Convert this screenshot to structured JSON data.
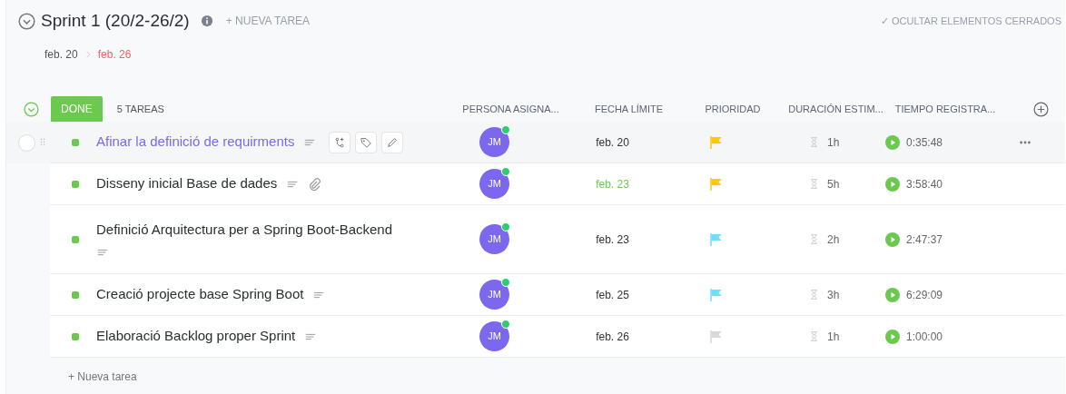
{
  "sprint": {
    "title": "Sprint 1 (20/2-26/2)",
    "new_task": "+ NUEVA TAREA",
    "hide_closed": "✓ OCULTAR ELEMENTOS CERRADOS",
    "start": "feb. 20",
    "end": "feb. 26",
    "expanded": true
  },
  "group": {
    "status": "DONE",
    "count": "5 TAREAS",
    "expanded": true
  },
  "columns": [
    "PERSONA ASIGNA...",
    "FECHA LÍMITE",
    "PRIORIDAD",
    "DURACIÓN ESTIM...",
    "TIEMPO REGISTRA..."
  ],
  "tasks": [
    {
      "name": "Afinar la definició de requirments",
      "hovered": true,
      "checked": false,
      "has_attachment": false,
      "assignee": "JM",
      "due": {
        "text": "feb. 20",
        "color": "#333333"
      },
      "priority": {
        "color": "#ffc800"
      },
      "estimate": "1h",
      "time": "0:35:48"
    },
    {
      "name": "Disseny inicial Base de dades",
      "hovered": false,
      "has_attachment": true,
      "assignee": "JM",
      "due": {
        "text": "feb. 23",
        "color": "#6bc950"
      },
      "priority": {
        "color": "#ffc800"
      },
      "estimate": "5h",
      "time": "3:58:40"
    },
    {
      "name": "Definició Arquitectura per a Spring Boot-Backend",
      "hovered": false,
      "has_attachment": false,
      "assignee": "JM",
      "due": {
        "text": "feb. 23",
        "color": "#333333"
      },
      "priority": {
        "color": "#6fddff"
      },
      "estimate": "2h",
      "time": "2:47:37"
    },
    {
      "name": "Creació projecte base Spring Boot",
      "hovered": false,
      "has_attachment": false,
      "assignee": "JM",
      "due": {
        "text": "feb. 25",
        "color": "#333333"
      },
      "priority": {
        "color": "#6fddff"
      },
      "estimate": "3h",
      "time": "6:29:09"
    },
    {
      "name": "Elaboració Backlog proper Sprint",
      "hovered": false,
      "has_attachment": false,
      "assignee": "JM",
      "due": {
        "text": "feb. 26",
        "color": "#333333"
      },
      "priority": {
        "color": "#d8d8d8"
      },
      "estimate": "1h",
      "time": "1:00:00"
    }
  ],
  "new_task_row": "+ Nueva tarea"
}
